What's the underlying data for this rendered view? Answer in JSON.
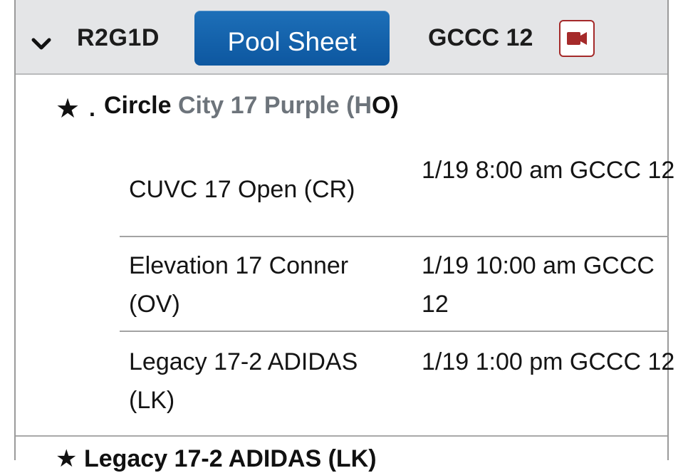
{
  "header": {
    "pool_code": "R2G1D",
    "pool_sheet_label": "Pool Sheet",
    "court": "GCCC 12",
    "icons": {
      "expand": "chevron-down-icon",
      "video": "video-camera-icon"
    },
    "colors": {
      "button": "#0d57a0",
      "video_icon": "#a52a2a"
    }
  },
  "team": {
    "star_icon": "star-icon",
    "dot": ".",
    "name_start": "Circle",
    "name_gray": " City 17 Purple (H",
    "name_end": "O)"
  },
  "matches": [
    {
      "opponent": "CUVC 17 Open (CR)",
      "when": "1/19 8:00 am GCCC 12"
    },
    {
      "opponent": "Elevation 17 Conner (OV)",
      "when": "1/19 10:00 am GCCC 12"
    },
    {
      "opponent": "Legacy 17-2 ADIDAS (LK)",
      "when": "1/19 1:00 pm GCCC 12"
    }
  ],
  "next_team": {
    "name": "Legacy 17-2 ADIDAS (LK)"
  }
}
